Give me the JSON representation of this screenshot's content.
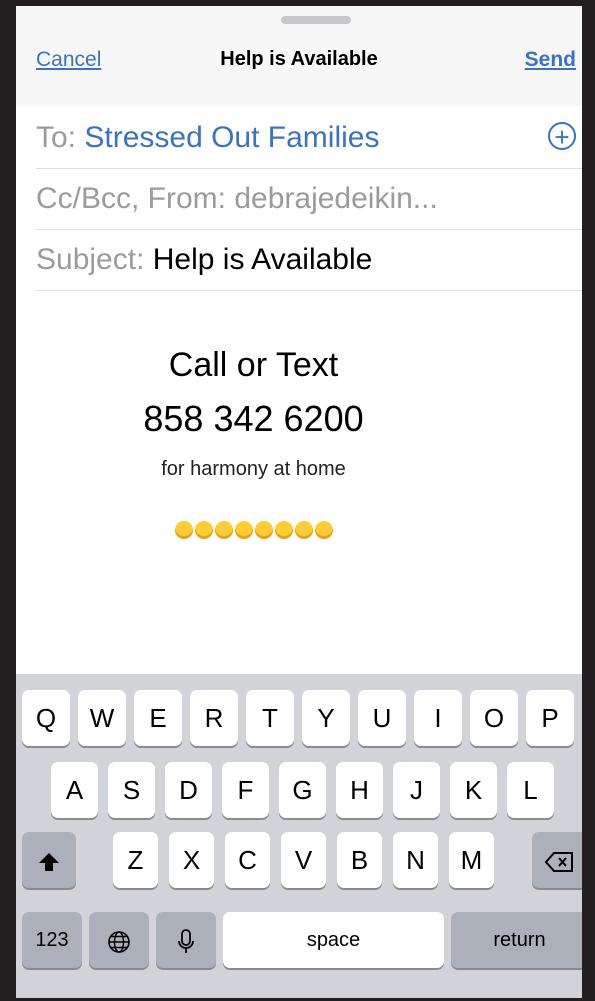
{
  "header": {
    "cancel_label": "Cancel",
    "title": "Help is Available",
    "send_label": "Send"
  },
  "fields": {
    "to_label": "To:",
    "to_value": "Stressed Out Families",
    "ccbcc_text": "Cc/Bcc, From: debrajedeikin...",
    "subject_label": "Subject:",
    "subject_value": "Help is Available"
  },
  "body": {
    "line1": "Call or Text",
    "line2": "858 342 6200",
    "line3": "for harmony at home",
    "emoji_count": 8,
    "emoji_names": [
      "heart-eyes",
      "relieved",
      "blush",
      "wink",
      "smiley",
      "grin",
      "smile",
      "sweat-smile"
    ]
  },
  "keyboard": {
    "row1": [
      "Q",
      "W",
      "E",
      "R",
      "T",
      "Y",
      "U",
      "I",
      "O",
      "P"
    ],
    "row2": [
      "A",
      "S",
      "D",
      "F",
      "G",
      "H",
      "J",
      "K",
      "L"
    ],
    "row3": [
      "Z",
      "X",
      "C",
      "V",
      "B",
      "N",
      "M"
    ],
    "shift_icon": "shift-arrow-icon",
    "delete_icon": "backspace-icon",
    "numbers_label": "123",
    "globe_icon": "globe-icon",
    "mic_icon": "microphone-icon",
    "space_label": "space",
    "return_label": "return"
  },
  "colors": {
    "accent": "#3a72c4",
    "background": "#231f20",
    "keyboard_bg": "#d1d3d9"
  }
}
